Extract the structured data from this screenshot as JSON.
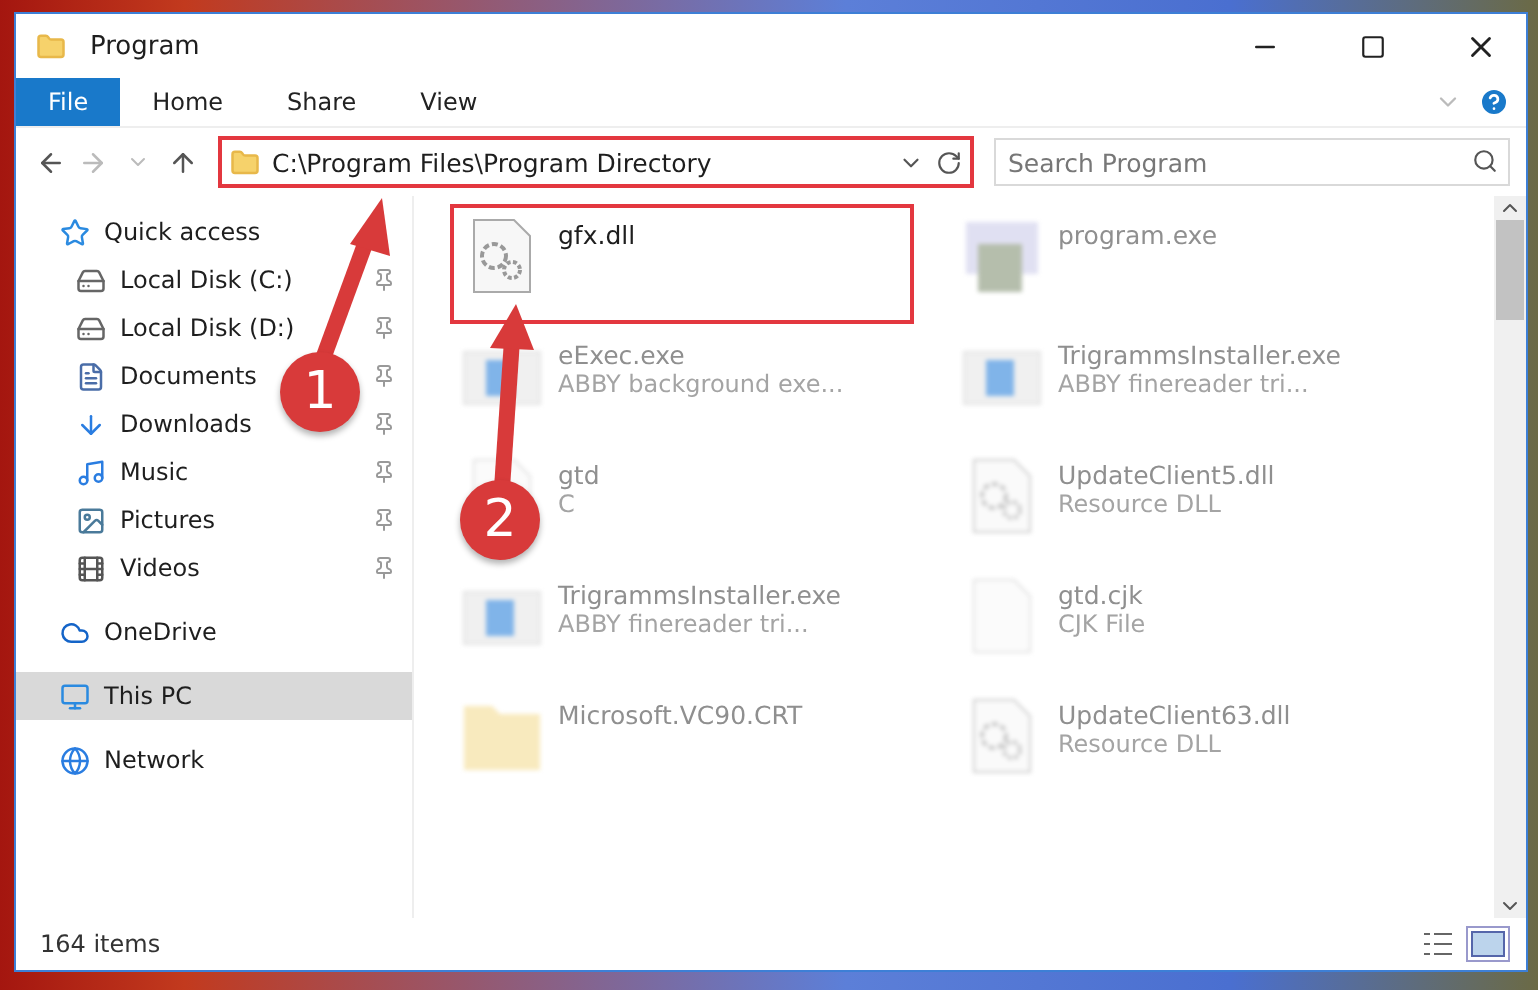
{
  "window": {
    "title": "Program"
  },
  "ribbon_tabs": [
    {
      "label": "File",
      "kind": "file"
    },
    {
      "label": "Home",
      "kind": "tab"
    },
    {
      "label": "Share",
      "kind": "tab"
    },
    {
      "label": "View",
      "kind": "tab"
    }
  ],
  "address": {
    "path": "C:\\Program Files\\Program Directory",
    "highlighted": true
  },
  "search": {
    "placeholder": "Search Program"
  },
  "sidebar": {
    "items": [
      {
        "label": "Quick access",
        "kind": "star",
        "selected": false,
        "children": [
          {
            "label": "Local Disk (C:)",
            "kind": "drive",
            "pinned": true
          },
          {
            "label": "Local Disk (D:)",
            "kind": "drive",
            "pinned": true
          },
          {
            "label": "Documents",
            "kind": "document",
            "pinned": true
          },
          {
            "label": "Downloads",
            "kind": "download",
            "pinned": true
          },
          {
            "label": "Music",
            "kind": "music",
            "pinned": true
          },
          {
            "label": "Pictures",
            "kind": "picture",
            "pinned": true
          },
          {
            "label": "Videos",
            "kind": "video",
            "pinned": true
          }
        ]
      },
      {
        "label": "OneDrive",
        "kind": "cloud",
        "selected": false
      },
      {
        "label": "This PC",
        "kind": "pc",
        "selected": true
      },
      {
        "label": "Network",
        "kind": "network",
        "selected": false
      }
    ]
  },
  "files": [
    {
      "name": "gfx.dll",
      "kind": "dll",
      "blurred": false,
      "highlighted": true
    },
    {
      "name": "program.exe",
      "kind": "program",
      "blurred": true,
      "highlighted": false
    },
    {
      "name": "eExec.exe",
      "detail": "ABBY background exe...",
      "kind": "app",
      "blurred": true,
      "highlighted": false
    },
    {
      "name": "TrigrammsInstaller.exe",
      "detail": "ABBY finereader tri...",
      "kind": "app",
      "blurred": true,
      "highlighted": false
    },
    {
      "name": "gtd",
      "detail": "C",
      "kind": "blank",
      "blurred": true,
      "highlighted": false
    },
    {
      "name": "UpdateClient5.dll",
      "detail": "Resource DLL",
      "kind": "dll",
      "blurred": true,
      "highlighted": false
    },
    {
      "name": "TrigrammsInstaller.exe",
      "detail": "ABBY finereader tri...",
      "kind": "app",
      "blurred": true,
      "highlighted": false
    },
    {
      "name": "gtd.cjk",
      "detail": "CJK File",
      "kind": "blank",
      "blurred": true,
      "highlighted": false
    },
    {
      "name": "Microsoft.VC90.CRT",
      "kind": "folder",
      "blurred": true,
      "highlighted": false
    },
    {
      "name": "UpdateClient63.dll",
      "detail": "Resource DLL",
      "kind": "dll",
      "blurred": true,
      "highlighted": false
    }
  ],
  "status_bar": {
    "count": "164 items"
  },
  "markers": [
    {
      "number": "1"
    },
    {
      "number": "2"
    }
  ]
}
